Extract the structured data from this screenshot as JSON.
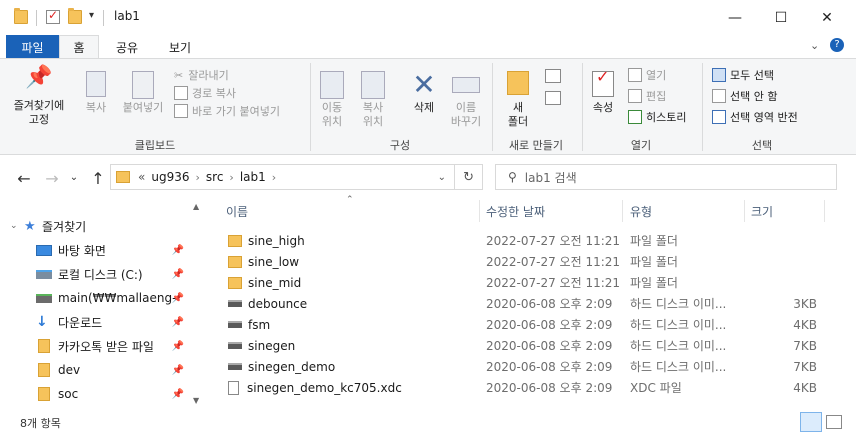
{
  "window": {
    "title": "lab1",
    "minimize": "—",
    "maximize": "☐",
    "close": "✕"
  },
  "tabs": {
    "file": "파일",
    "home": "홈",
    "share": "공유",
    "view": "보기"
  },
  "ribbon": {
    "clipboard": {
      "label": "클립보드",
      "pin": "즐겨찾기에\n고정",
      "copy": "복사",
      "paste": "붙여넣기",
      "cut": "잘라내기",
      "copy_path": "경로 복사",
      "paste_shortcut": "바로 가기 붙여넣기"
    },
    "organize": {
      "label": "구성",
      "move_to": "이동\n위치",
      "copy_to": "복사\n위치",
      "delete": "삭제",
      "rename": "이름\n바꾸기"
    },
    "new": {
      "label": "새로 만들기",
      "new_folder": "새\n폴더"
    },
    "open": {
      "label": "열기",
      "properties": "속성",
      "open": "열기",
      "edit": "편집",
      "history": "히스토리"
    },
    "select": {
      "label": "선택",
      "select_all": "모두 선택",
      "select_none": "선택 안 함",
      "invert": "선택 영역 반전"
    }
  },
  "address": {
    "overflow": "«",
    "crumbs": [
      "ug936",
      "src",
      "lab1"
    ],
    "search_placeholder": "lab1 검색"
  },
  "nav": {
    "items": [
      {
        "label": "즐겨찾기",
        "icon": "star-icon"
      },
      {
        "label": "바탕 화면",
        "icon": "desktop-icon"
      },
      {
        "label": "로컬 디스크 (C:)",
        "icon": "drive-icon"
      },
      {
        "label": "main(₩₩mallaeng-na",
        "icon": "network-drive-icon"
      },
      {
        "label": "다운로드",
        "icon": "download-icon"
      },
      {
        "label": "카카오톡 받은 파일",
        "icon": "folder-icon"
      },
      {
        "label": "dev",
        "icon": "folder-icon"
      },
      {
        "label": "soc",
        "icon": "folder-icon"
      }
    ]
  },
  "columns": {
    "name": "이름",
    "modified": "수정한 날짜",
    "type": "유형",
    "size": "크기"
  },
  "files": [
    {
      "name": "sine_high",
      "modified": "2022-07-27 오전 11:21",
      "type": "파일 폴더",
      "size": "",
      "icon": "folder-icon"
    },
    {
      "name": "sine_low",
      "modified": "2022-07-27 오전 11:21",
      "type": "파일 폴더",
      "size": "",
      "icon": "folder-icon"
    },
    {
      "name": "sine_mid",
      "modified": "2022-07-27 오전 11:21",
      "type": "파일 폴더",
      "size": "",
      "icon": "folder-icon"
    },
    {
      "name": "debounce",
      "modified": "2020-06-08 오후 2:09",
      "type": "하드 디스크 이미...",
      "size": "3KB",
      "icon": "disk-image-icon"
    },
    {
      "name": "fsm",
      "modified": "2020-06-08 오후 2:09",
      "type": "하드 디스크 이미...",
      "size": "4KB",
      "icon": "disk-image-icon"
    },
    {
      "name": "sinegen",
      "modified": "2020-06-08 오후 2:09",
      "type": "하드 디스크 이미...",
      "size": "7KB",
      "icon": "disk-image-icon"
    },
    {
      "name": "sinegen_demo",
      "modified": "2020-06-08 오후 2:09",
      "type": "하드 디스크 이미...",
      "size": "7KB",
      "icon": "disk-image-icon"
    },
    {
      "name": "sinegen_demo_kc705.xdc",
      "modified": "2020-06-08 오후 2:09",
      "type": "XDC 파일",
      "size": "4KB",
      "icon": "document-icon"
    }
  ],
  "status": {
    "count": "8개 항목"
  },
  "colors": {
    "file_tab": "#1a62b8",
    "folder": "#f6c35b",
    "ribbon_bg": "#f5f6f7"
  }
}
